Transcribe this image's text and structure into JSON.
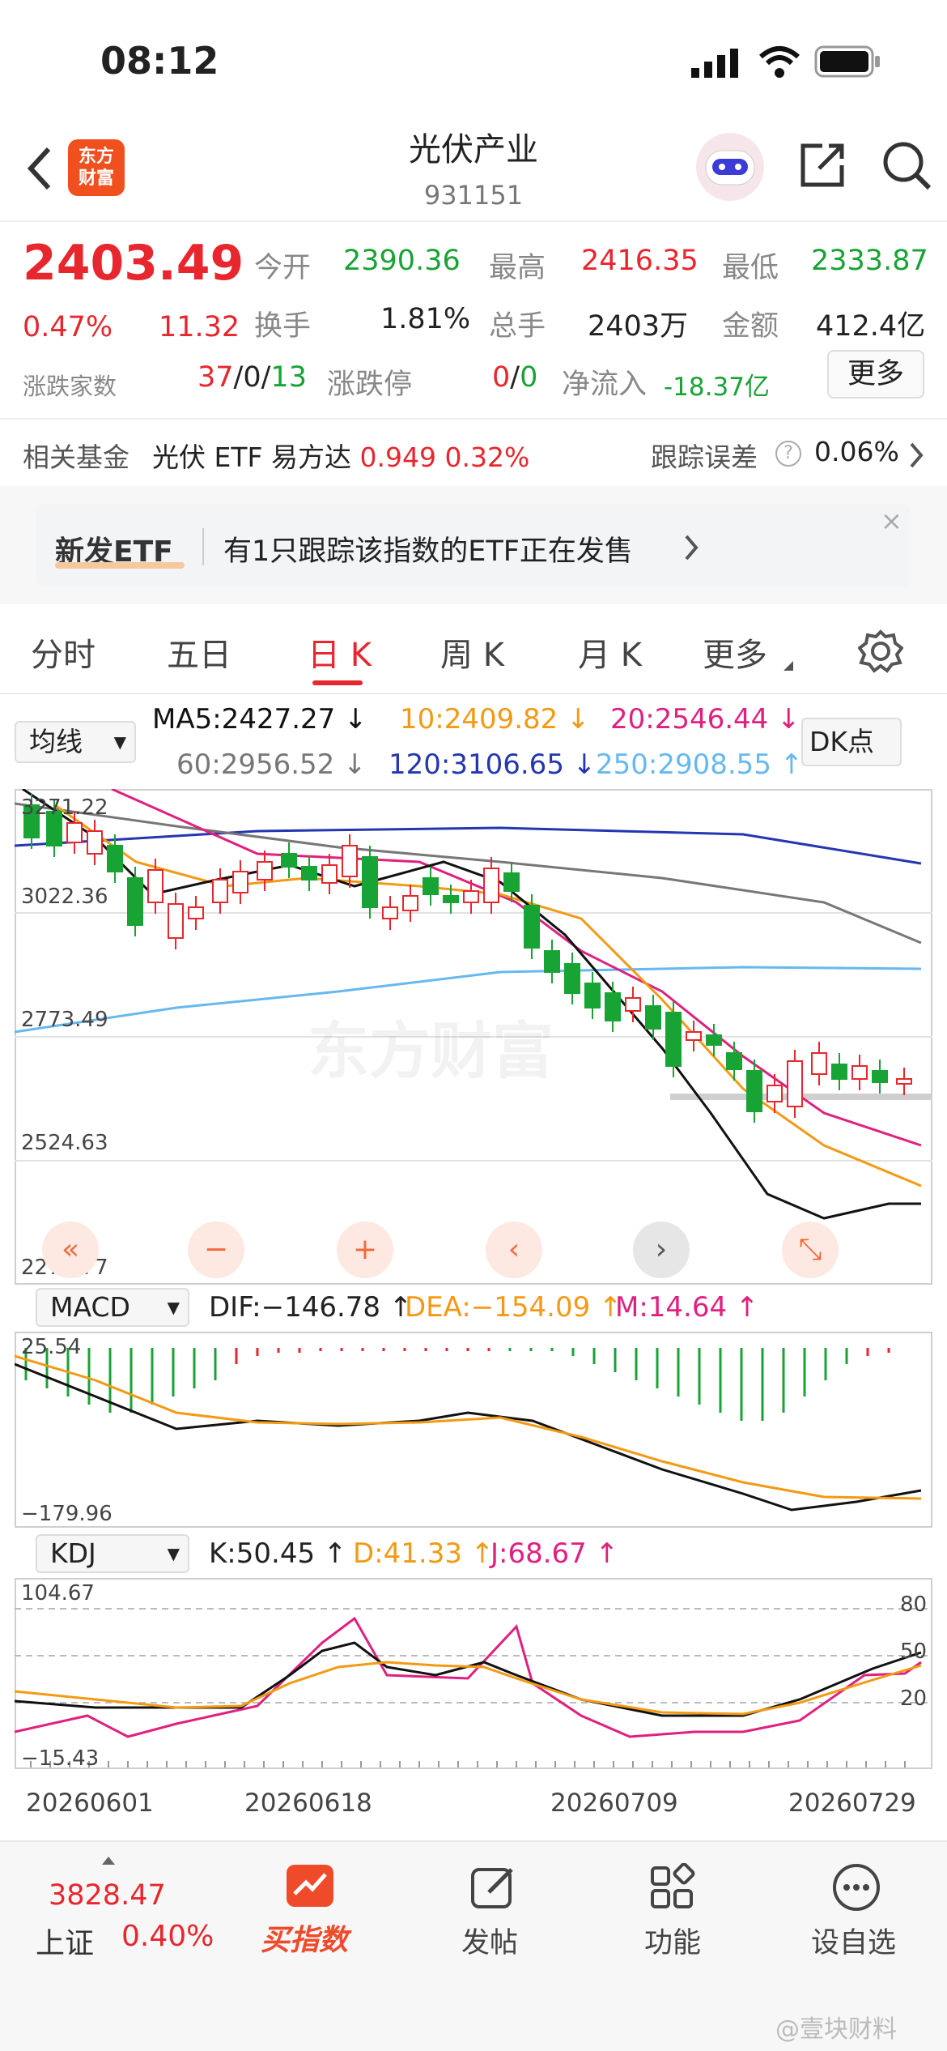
{
  "status": {
    "time": "08:12"
  },
  "header": {
    "title": "光伏产业",
    "code": "931151",
    "logo_lines": [
      "东方",
      "财富"
    ]
  },
  "quote": {
    "price": "2403.49",
    "pct": "0.47%",
    "chg": "11.32",
    "open_label": "今开",
    "open": "2390.36",
    "high_label": "最高",
    "high": "2416.35",
    "low_label": "最低",
    "low": "2333.87",
    "turnover_label": "换手",
    "turnover": "1.81%",
    "volume_label": "总手",
    "volume": "2403万",
    "amount_label": "金额",
    "amount": "412.4亿",
    "updown_label": "涨跌家数",
    "up": "37",
    "flat": "0",
    "down": "13",
    "limit_label": "涨跌停",
    "limit_up": "0",
    "limit_down": "0",
    "netflow_label": "净流入",
    "netflow": "-18.37亿",
    "more": "更多"
  },
  "fund": {
    "label": "相关基金",
    "name": "光伏 ETF 易方达",
    "price": "0.949",
    "pct": "0.32%",
    "track_label": "跟踪误差",
    "track": "0.06%"
  },
  "banner": {
    "tag": "新发ETF",
    "text": "有1只跟踪该指数的ETF正在发售",
    "close": "×"
  },
  "tabs": [
    "分时",
    "五日",
    "日 K",
    "周 K",
    "月 K",
    "更多"
  ],
  "ma": {
    "selector": "均线",
    "ma5": "MA5:2427.27 ↓",
    "ma10": "10:2409.82 ↓",
    "ma20": "20:2546.44 ↓",
    "ma60": "60:2956.52 ↓",
    "ma120": "120:3106.65 ↓",
    "ma250": "250:2908.55 ↑",
    "dk": "DK点"
  },
  "kline_axis": [
    "3271.22",
    "3022.36",
    "2773.49",
    "2524.63",
    "2275.77"
  ],
  "macd": {
    "selector": "MACD",
    "dif": "DIF:−146.78 ↑",
    "dea": "DEA:−154.09 ↑",
    "m": "M:14.64 ↑",
    "axis_top": "25.54",
    "axis_bottom": "−179.96"
  },
  "kdj": {
    "selector": "KDJ",
    "k": "K:50.45 ↑",
    "d": "D:41.33 ↑",
    "j": "J:68.67 ↑",
    "axis_top": "104.67",
    "axis_bottom": "−15.43",
    "levels": [
      "80",
      "50",
      "20"
    ]
  },
  "dates": [
    "20260601",
    "20260618",
    "20260709",
    "20260729"
  ],
  "bottom": {
    "index_value": "3828.47",
    "index_name": "上证",
    "index_pct": "0.40%",
    "buy": "买指数",
    "post": "发帖",
    "func": "功能",
    "watch": "设自选"
  },
  "watermark": "东方财富",
  "weibo": "@壹块财料",
  "colors": {
    "up": "#e8262d",
    "down": "#18a335",
    "ma5": "#111111",
    "ma10": "#f39a14",
    "ma20": "#e0207f",
    "ma60": "#777777",
    "ma120": "#2436b0",
    "ma250": "#66b8ef"
  }
}
